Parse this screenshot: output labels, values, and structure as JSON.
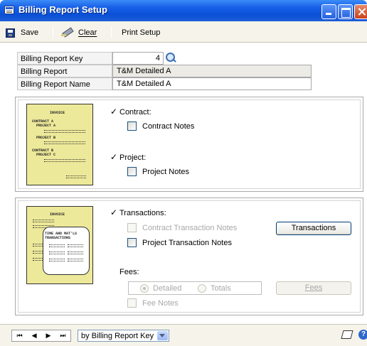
{
  "window": {
    "title": "Billing Report Setup"
  },
  "toolbar": {
    "save_label": "Save",
    "clear_label": "Clear",
    "print_setup_label": "Print Setup"
  },
  "header": {
    "key_label": "Billing Report Key",
    "key_value": "4",
    "report_label": "Billing Report",
    "report_value": "T&M Detailed A",
    "name_label": "Billing Report Name",
    "name_value": "T&M Detailed A"
  },
  "invoice1": {
    "lines": [
      "INVOICE",
      "CONTRACT A",
      "  PROJECT A",
      "  PROJECT B",
      "CONTRACT B",
      "  PROJECT C"
    ]
  },
  "invoice2": {
    "title": "INVOICE",
    "callout": "TIME AND MAT'LS\nTRANSACTIONS"
  },
  "contract": {
    "check": "✓",
    "label": "Contract:",
    "notes_label": "Contract Notes",
    "notes_checked": false
  },
  "project": {
    "check": "✓",
    "label": "Project:",
    "notes_label": "Project Notes",
    "notes_checked": false
  },
  "transactions": {
    "check": "✓",
    "label": "Transactions:",
    "contract_notes_label": "Contract Transaction Notes",
    "project_notes_label": "Project Transaction Notes",
    "button_label": "Transactions"
  },
  "fees": {
    "label": "Fees:",
    "detailed_label": "Detailed",
    "totals_label": "Totals",
    "selected": "Detailed",
    "button_label": "Fees",
    "fee_notes_label": "Fee Notes"
  },
  "bottom": {
    "sort_value": "by Billing Report Key",
    "nav_first": "⏮",
    "nav_prev": "◀",
    "nav_next": "▶",
    "nav_last": "⏭",
    "help_symbol": "?"
  },
  "colors": {
    "titlebar": "#1760e8",
    "invoice_paper": "#ede99a",
    "disabled_text": "#a8a8a8"
  }
}
